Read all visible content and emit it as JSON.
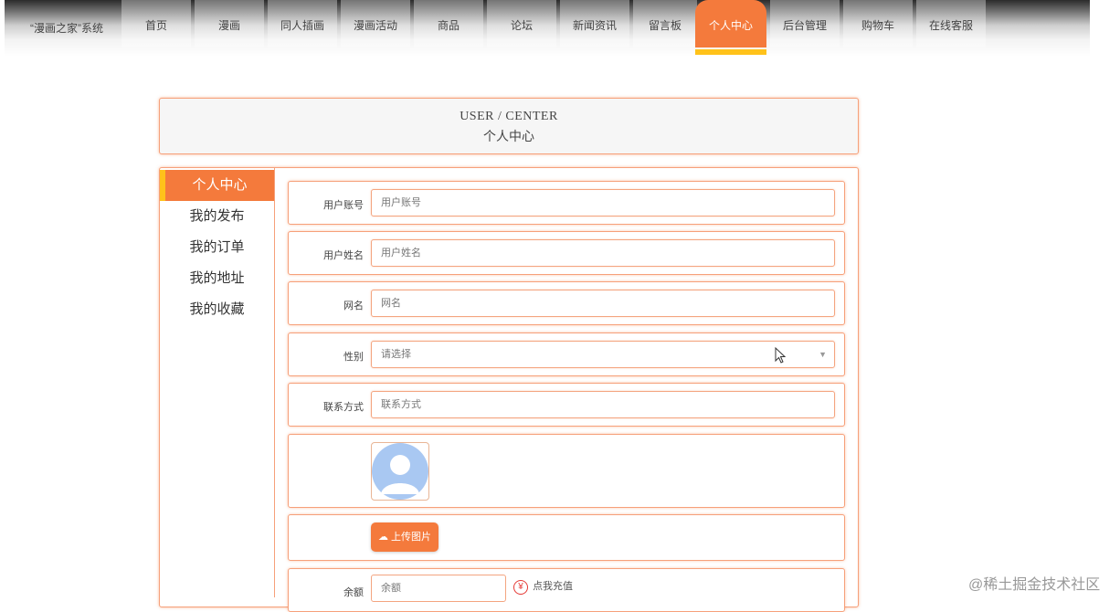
{
  "nav": {
    "brand": "“漫画之家”系统",
    "items": [
      {
        "label": "首页",
        "active": false
      },
      {
        "label": "漫画",
        "active": false
      },
      {
        "label": "同人插画",
        "active": false
      },
      {
        "label": "漫画活动",
        "active": false
      },
      {
        "label": "商品",
        "active": false
      },
      {
        "label": "论坛",
        "active": false
      },
      {
        "label": "新闻资讯",
        "active": false
      },
      {
        "label": "留言板",
        "active": false
      },
      {
        "label": "个人中心",
        "active": true
      },
      {
        "label": "后台管理",
        "active": false
      },
      {
        "label": "购物车",
        "active": false
      },
      {
        "label": "在线客服",
        "active": false
      }
    ]
  },
  "page_title": {
    "en": "USER / CENTER",
    "cn": "个人中心"
  },
  "side_menu": [
    {
      "label": "个人中心",
      "active": true
    },
    {
      "label": "我的发布",
      "active": false
    },
    {
      "label": "我的订单",
      "active": false
    },
    {
      "label": "我的地址",
      "active": false
    },
    {
      "label": "我的收藏",
      "active": false
    }
  ],
  "form": {
    "account": {
      "label": "用户账号",
      "placeholder": "用户账号"
    },
    "name": {
      "label": "用户姓名",
      "placeholder": "用户姓名"
    },
    "nickname": {
      "label": "网名",
      "placeholder": "网名"
    },
    "gender": {
      "label": "性别",
      "placeholder": "请选择"
    },
    "contact": {
      "label": "联系方式",
      "placeholder": "联系方式"
    },
    "upload_label": "上传图片",
    "balance": {
      "label": "余额",
      "placeholder": "余额",
      "recharge_label": "点我充值"
    }
  },
  "watermark": "@稀土掘金技术社区",
  "colors": {
    "accent": "#f47a3c",
    "highlight": "#ffc21a"
  },
  "icons": {
    "avatar": "default-avatar-icon",
    "upload": "cloud-upload-icon",
    "recharge": "yen-icon",
    "dropdown": "chevron-down-icon"
  }
}
